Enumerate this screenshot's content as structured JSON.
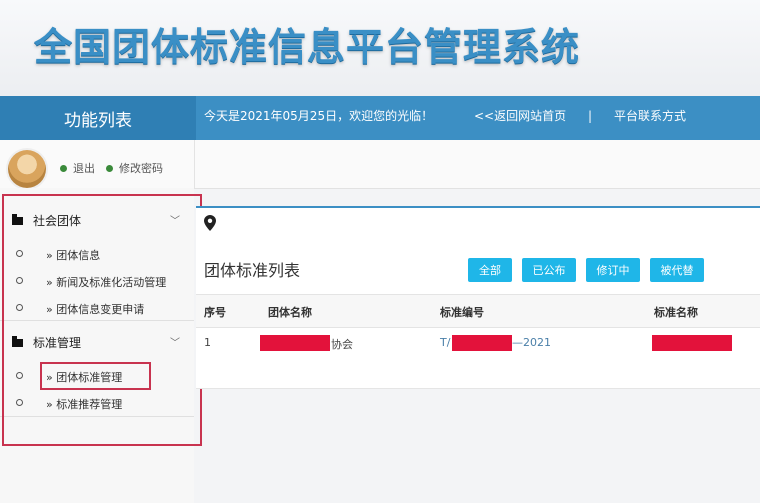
{
  "banner": {
    "title": "全国团体标准信息平台管理系统"
  },
  "topbar": {
    "menu_title": "功能列表",
    "welcome": "今天是2021年05月25日，欢迎您的光临！",
    "home_link": "<<返回网站首页",
    "separator": "|",
    "contact_link": "平台联系方式"
  },
  "user": {
    "logout": "退出",
    "change_password": "修改密码"
  },
  "sidebar": {
    "groups": [
      {
        "title": "社会团体",
        "items": [
          "» 团体信息",
          "» 新闻及标准化活动管理",
          "» 团体信息变更申请"
        ]
      },
      {
        "title": "标准管理",
        "items": [
          "» 团体标准管理",
          "» 标准推荐管理"
        ]
      }
    ],
    "chevron": "﹀"
  },
  "main": {
    "title": "团体标准列表",
    "filters": [
      "全部",
      "已公布",
      "修订中",
      "被代替"
    ],
    "columns": [
      "序号",
      "团体名称",
      "标准编号",
      "标准名称"
    ],
    "rows": [
      {
        "index": "1",
        "org_suffix": "协会",
        "code_prefix": "T/",
        "code_suffix": "—2021"
      }
    ]
  },
  "colors": {
    "accent": "#3c8fc4",
    "button": "#1fb6e8",
    "highlight": "#c8334f",
    "redaction": "#e3123b"
  },
  "icons": [
    "folder-icon",
    "chevron-down-icon",
    "map-pin-icon",
    "avatar"
  ]
}
